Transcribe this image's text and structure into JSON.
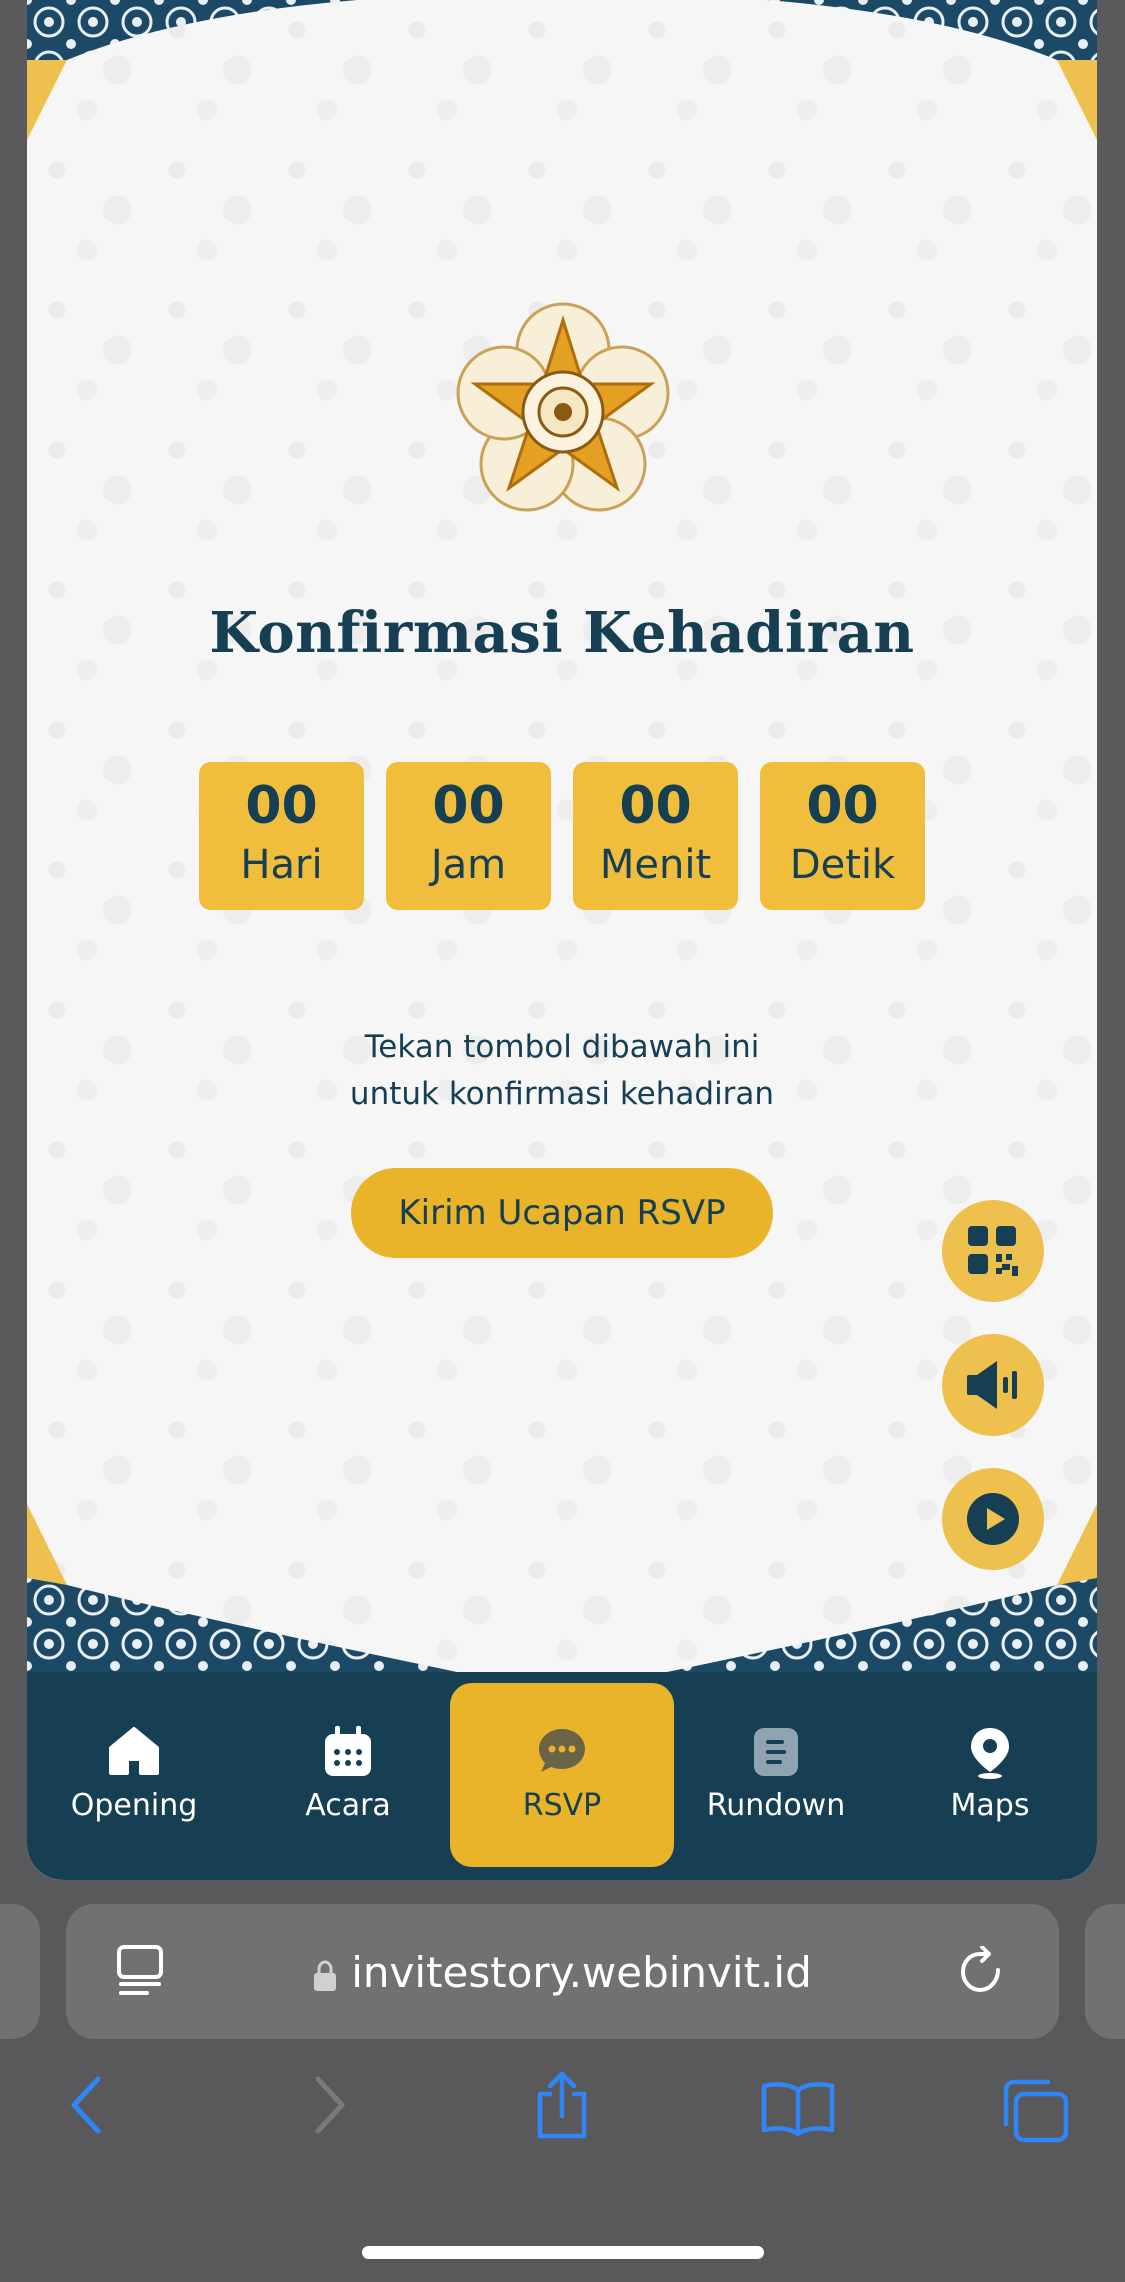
{
  "invitation": {
    "title": "Konfirmasi Kehadiran",
    "emblem_icon": "university-emblem",
    "countdown": [
      {
        "value": "00",
        "label": "Hari"
      },
      {
        "value": "00",
        "label": "Jam"
      },
      {
        "value": "00",
        "label": "Menit"
      },
      {
        "value": "00",
        "label": "Detik"
      }
    ],
    "hint_line1": "Tekan tombol dibawah ini",
    "hint_line2": "untuk konfirmasi kehadiran",
    "rsvp_button": "Kirim Ucapan RSVP"
  },
  "fabs": [
    {
      "icon": "qr-code-icon"
    },
    {
      "icon": "speaker-icon"
    },
    {
      "icon": "play-icon"
    }
  ],
  "bottom_nav": {
    "items": [
      {
        "label": "Opening",
        "icon": "home-icon"
      },
      {
        "label": "Acara",
        "icon": "calendar-icon"
      },
      {
        "label": "RSVP",
        "icon": "chat-icon",
        "active": true
      },
      {
        "label": "Rundown",
        "icon": "document-icon"
      },
      {
        "label": "Maps",
        "icon": "map-pin-icon"
      }
    ]
  },
  "browser": {
    "url": "invitestory.webinvit.id"
  },
  "colors": {
    "navy": "#163f54",
    "gold": "#e9b42a",
    "gold_light": "#f0be3c",
    "accent_blue": "#2f86f6"
  }
}
